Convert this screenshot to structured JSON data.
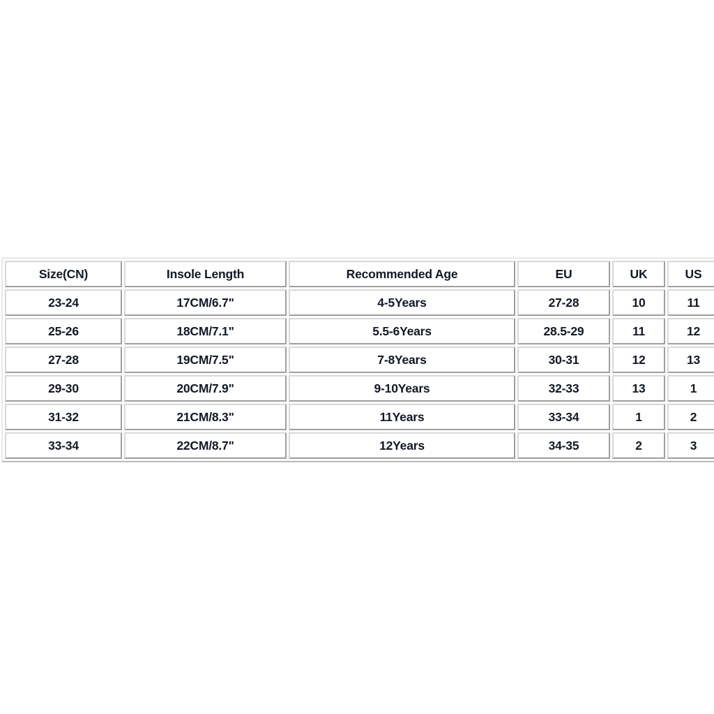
{
  "page": {
    "background_color": "#ffffff",
    "text_color": "#111827",
    "border_color": "#9e9e9e"
  },
  "size_chart": {
    "columns": [
      "Size(CN)",
      "Insole Length",
      "Recommended Age",
      "EU",
      "UK",
      "US"
    ],
    "rows": [
      [
        "23-24",
        "17CM/6.7\"",
        "4-5Years",
        "27-28",
        "10",
        "11"
      ],
      [
        "25-26",
        "18CM/7.1\"",
        "5.5-6Years",
        "28.5-29",
        "11",
        "12"
      ],
      [
        "27-28",
        "19CM/7.5\"",
        "7-8Years",
        "30-31",
        "12",
        "13"
      ],
      [
        "29-30",
        "20CM/7.9\"",
        "9-10Years",
        "32-33",
        "13",
        "1"
      ],
      [
        "31-32",
        "21CM/8.3\"",
        "11Years",
        "33-34",
        "1",
        "2"
      ],
      [
        "33-34",
        "22CM/8.7\"",
        "12Years",
        "34-35",
        "2",
        "3"
      ]
    ]
  }
}
